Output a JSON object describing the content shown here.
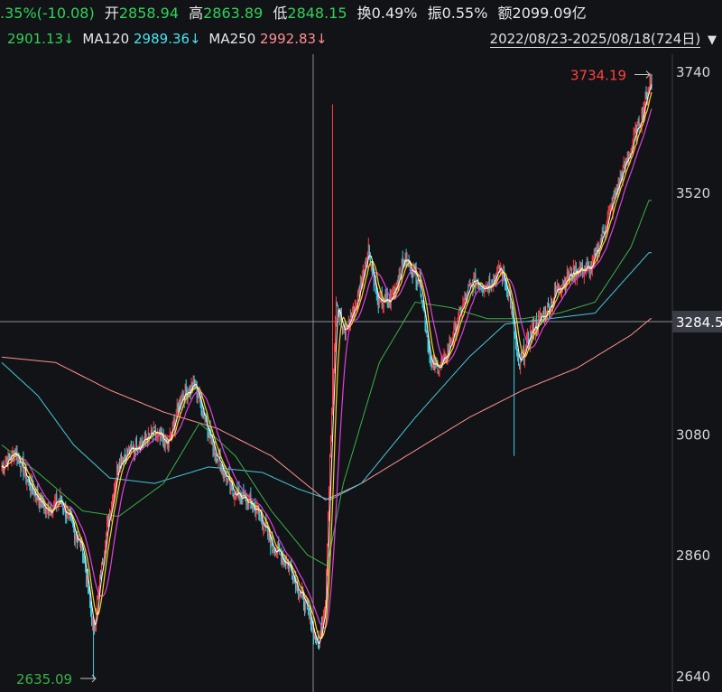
{
  "header": {
    "change": ".35%(-10.08)",
    "open_label": "开",
    "open_value": "2858.94",
    "high_label": "高",
    "high_value": "2863.89",
    "low_label": "低",
    "low_value": "2848.15",
    "turnover_label": "换",
    "turnover_value": "0.49%",
    "amplitude_label": "振",
    "amplitude_value": "0.55%",
    "amount_label": "额",
    "amount_value": "2099.09亿"
  },
  "ma_row": {
    "ma60_value": "2901.13↓",
    "ma120_label": "MA120",
    "ma120_value": "2989.36↓",
    "ma250_label": "MA250",
    "ma250_value": "2992.83↓"
  },
  "range": {
    "text": "2022/08/23-2025/08/18(724日)",
    "dropdown_icon": "triangle-down-icon"
  },
  "colors": {
    "background": "#121317",
    "up": "#ff4040",
    "down": "#3ad0e0",
    "ma5": "#ffffff",
    "ma10": "#ffd11a",
    "ma20": "#e040e0",
    "ma60": "#3cb043",
    "ma120": "#47c8d8",
    "ma250": "#ff9090"
  },
  "chart_data": {
    "type": "line",
    "y_axis_ticks": [
      "3740",
      "3520",
      "3080",
      "2860",
      "2640"
    ],
    "y_tick_values": [
      3740,
      3520,
      3080,
      2860,
      2640
    ],
    "ylim": [
      2620,
      3775
    ],
    "current_price_label": "3284.5",
    "current_price": 3284.5,
    "high_annotation": "3734.19",
    "high_value": 3734.19,
    "low_annotation": "2635.09",
    "low_value": 2635.09,
    "x_count": 724,
    "close_keypoints": [
      [
        0,
        3020
      ],
      [
        15,
        3050
      ],
      [
        30,
        2990
      ],
      [
        50,
        2940
      ],
      [
        65,
        2960
      ],
      [
        90,
        2870
      ],
      [
        102,
        2720
      ],
      [
        115,
        2890
      ],
      [
        130,
        3030
      ],
      [
        150,
        3060
      ],
      [
        170,
        3080
      ],
      [
        185,
        3060
      ],
      [
        200,
        3150
      ],
      [
        215,
        3170
      ],
      [
        235,
        3060
      ],
      [
        255,
        2980
      ],
      [
        270,
        2960
      ],
      [
        285,
        2940
      ],
      [
        300,
        2880
      ],
      [
        320,
        2840
      ],
      [
        340,
        2760
      ],
      [
        352,
        2690
      ],
      [
        360,
        2780
      ],
      [
        366,
        3080
      ],
      [
        372,
        3330
      ],
      [
        380,
        3260
      ],
      [
        395,
        3320
      ],
      [
        408,
        3420
      ],
      [
        418,
        3320
      ],
      [
        432,
        3320
      ],
      [
        448,
        3400
      ],
      [
        465,
        3360
      ],
      [
        478,
        3200
      ],
      [
        492,
        3210
      ],
      [
        510,
        3300
      ],
      [
        525,
        3360
      ],
      [
        540,
        3350
      ],
      [
        555,
        3380
      ],
      [
        565,
        3330
      ],
      [
        575,
        3200
      ],
      [
        590,
        3270
      ],
      [
        605,
        3300
      ],
      [
        620,
        3350
      ],
      [
        640,
        3380
      ],
      [
        655,
        3380
      ],
      [
        670,
        3450
      ],
      [
        685,
        3530
      ],
      [
        700,
        3600
      ],
      [
        712,
        3660
      ],
      [
        723,
        3734
      ]
    ],
    "ma60_keypoints": [
      [
        0,
        3060
      ],
      [
        40,
        3010
      ],
      [
        90,
        2940
      ],
      [
        130,
        2930
      ],
      [
        180,
        2990
      ],
      [
        220,
        3100
      ],
      [
        260,
        3040
      ],
      [
        300,
        2940
      ],
      [
        340,
        2860
      ],
      [
        362,
        2840
      ],
      [
        380,
        2990
      ],
      [
        420,
        3210
      ],
      [
        460,
        3320
      ],
      [
        500,
        3310
      ],
      [
        540,
        3290
      ],
      [
        580,
        3290
      ],
      [
        620,
        3300
      ],
      [
        660,
        3320
      ],
      [
        700,
        3420
      ],
      [
        720,
        3505
      ]
    ],
    "ma120_keypoints": [
      [
        0,
        3210
      ],
      [
        40,
        3150
      ],
      [
        80,
        3060
      ],
      [
        120,
        3000
      ],
      [
        170,
        2990
      ],
      [
        230,
        3020
      ],
      [
        290,
        3010
      ],
      [
        330,
        2980
      ],
      [
        365,
        2960
      ],
      [
        400,
        2990
      ],
      [
        460,
        3110
      ],
      [
        520,
        3220
      ],
      [
        560,
        3280
      ],
      [
        610,
        3290
      ],
      [
        660,
        3300
      ],
      [
        720,
        3410
      ]
    ],
    "ma250_keypoints": [
      [
        0,
        3220
      ],
      [
        60,
        3210
      ],
      [
        120,
        3160
      ],
      [
        180,
        3120
      ],
      [
        240,
        3090
      ],
      [
        300,
        3040
      ],
      [
        360,
        2960
      ],
      [
        400,
        2990
      ],
      [
        460,
        3050
      ],
      [
        520,
        3110
      ],
      [
        580,
        3160
      ],
      [
        640,
        3200
      ],
      [
        700,
        3260
      ],
      [
        722,
        3290
      ]
    ]
  }
}
